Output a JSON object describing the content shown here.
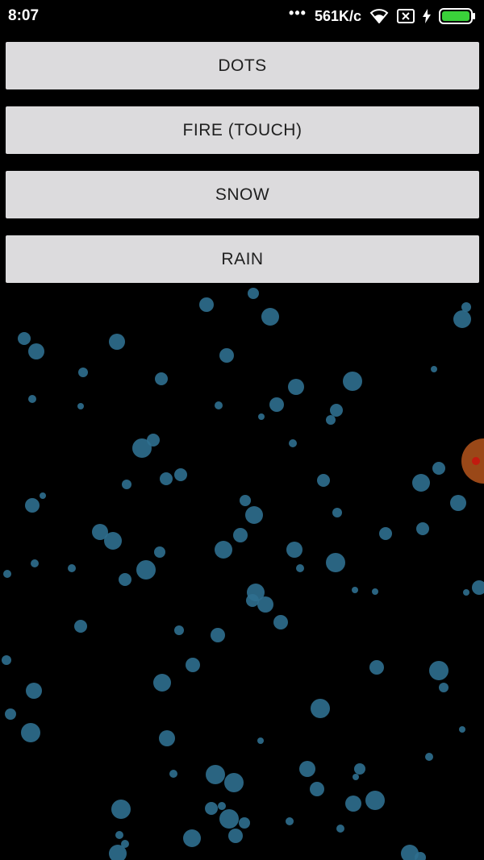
{
  "status_bar": {
    "time": "8:07",
    "network_speed": "561K/c",
    "icons": [
      "more-dots-icon",
      "wifi-icon",
      "no-sim-icon",
      "charging-bolt-icon",
      "battery-icon"
    ]
  },
  "buttons": [
    {
      "label": "DOTS"
    },
    {
      "label": "FIRE (TOUCH)"
    },
    {
      "label": "SNOW"
    },
    {
      "label": "RAIN"
    }
  ],
  "colors": {
    "background": "#000000",
    "button": "#dcdbdd",
    "button_text": "#1f1f1f",
    "particle": "#2f6f8f",
    "battery": "#3ad13a",
    "fire_particle": "#b5551c"
  }
}
